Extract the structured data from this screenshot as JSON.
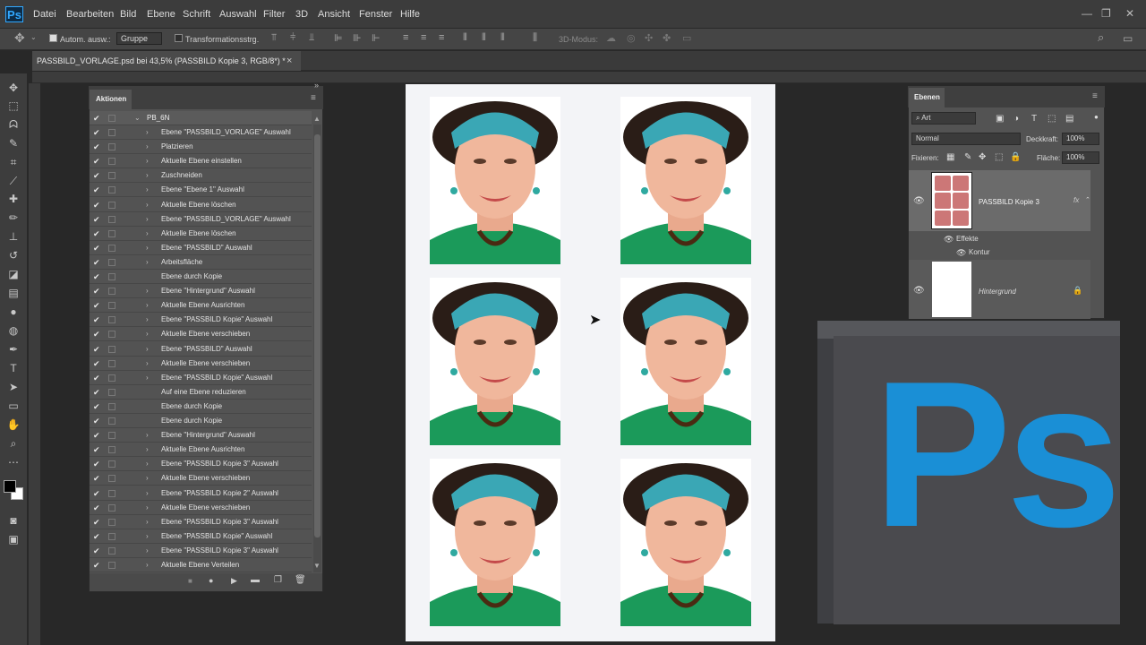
{
  "app": {
    "logo": "Ps"
  },
  "menu": [
    "Datei",
    "Bearbeiten",
    "Bild",
    "Ebene",
    "Schrift",
    "Auswahl",
    "Filter",
    "3D",
    "Ansicht",
    "Fenster",
    "Hilfe"
  ],
  "window_controls": {
    "minimize": "—",
    "restore": "❐",
    "close": "✕"
  },
  "options": {
    "auto_select_label": "Autom. ausw.:",
    "group_value": "Gruppe",
    "transform_label": "Transformationsstrg.",
    "mode_3d": "3D-Modus:"
  },
  "document_tab": {
    "title": "PASSBILD_VORLAGE.psd bei 43,5% (PASSBILD Kopie 3, RGB/8*) *",
    "close": "×"
  },
  "actions_panel": {
    "tab_label": "Aktionen",
    "set_name": "PB_6N",
    "items": [
      {
        "label": "Ebene \"PASSBILD_VORLAGE\" Auswahl",
        "expand": true
      },
      {
        "label": "Platzieren",
        "expand": true
      },
      {
        "label": "Aktuelle Ebene einstellen",
        "expand": true
      },
      {
        "label": "Zuschneiden",
        "expand": true
      },
      {
        "label": "Ebene \"Ebene 1\" Auswahl",
        "expand": true
      },
      {
        "label": "Aktuelle Ebene löschen",
        "expand": true
      },
      {
        "label": "Ebene \"PASSBILD_VORLAGE\" Auswahl",
        "expand": true
      },
      {
        "label": "Aktuelle Ebene löschen",
        "expand": true
      },
      {
        "label": "Ebene \"PASSBILD\" Auswahl",
        "expand": true
      },
      {
        "label": "Arbeitsfläche",
        "expand": true
      },
      {
        "label": "Ebene durch Kopie",
        "expand": false
      },
      {
        "label": "Ebene \"Hintergrund\" Auswahl",
        "expand": true
      },
      {
        "label": "Aktuelle Ebene Ausrichten",
        "expand": true
      },
      {
        "label": "Ebene \"PASSBILD Kopie\" Auswahl",
        "expand": true
      },
      {
        "label": "Aktuelle Ebene verschieben",
        "expand": true
      },
      {
        "label": "Ebene \"PASSBILD\" Auswahl",
        "expand": true
      },
      {
        "label": "Aktuelle Ebene verschieben",
        "expand": true
      },
      {
        "label": "Ebene \"PASSBILD Kopie\" Auswahl",
        "expand": true
      },
      {
        "label": "Auf eine Ebene reduzieren",
        "expand": false
      },
      {
        "label": "Ebene durch Kopie",
        "expand": false
      },
      {
        "label": "Ebene durch Kopie",
        "expand": false
      },
      {
        "label": "Ebene \"Hintergrund\" Auswahl",
        "expand": true
      },
      {
        "label": "Aktuelle Ebene Ausrichten",
        "expand": true
      },
      {
        "label": "Ebene \"PASSBILD Kopie 3\" Auswahl",
        "expand": true
      },
      {
        "label": "Aktuelle Ebene verschieben",
        "expand": true
      },
      {
        "label": "Ebene \"PASSBILD Kopie 2\" Auswahl",
        "expand": true
      },
      {
        "label": "Aktuelle Ebene verschieben",
        "expand": true
      },
      {
        "label": "Ebene \"PASSBILD Kopie 3\" Auswahl",
        "expand": true
      },
      {
        "label": "Ebene \"PASSBILD Kopie\" Auswahl",
        "expand": true
      },
      {
        "label": "Ebene \"PASSBILD Kopie 3\" Auswahl",
        "expand": true
      },
      {
        "label": "Aktuelle Ebene Verteilen",
        "expand": true
      }
    ]
  },
  "layers_panel": {
    "tab_label": "Ebenen",
    "filter_kind": "Art",
    "blend_mode": "Normal",
    "opacity_label": "Deckkraft:",
    "opacity_value": "100%",
    "lock_label": "Fixieren:",
    "fill_label": "Fläche:",
    "fill_value": "100%",
    "layers": [
      {
        "name": "PASSBILD Kopie 3",
        "fx": "fx",
        "effects_label": "Effekte",
        "effect": "Kontur"
      },
      {
        "name": "Hintergrund"
      }
    ]
  },
  "colors": {
    "accent": "#31a8ff",
    "ps_logo_blue": "#1a8fd6",
    "panel": "#535353",
    "ui_dark": "#3c3c3c"
  }
}
